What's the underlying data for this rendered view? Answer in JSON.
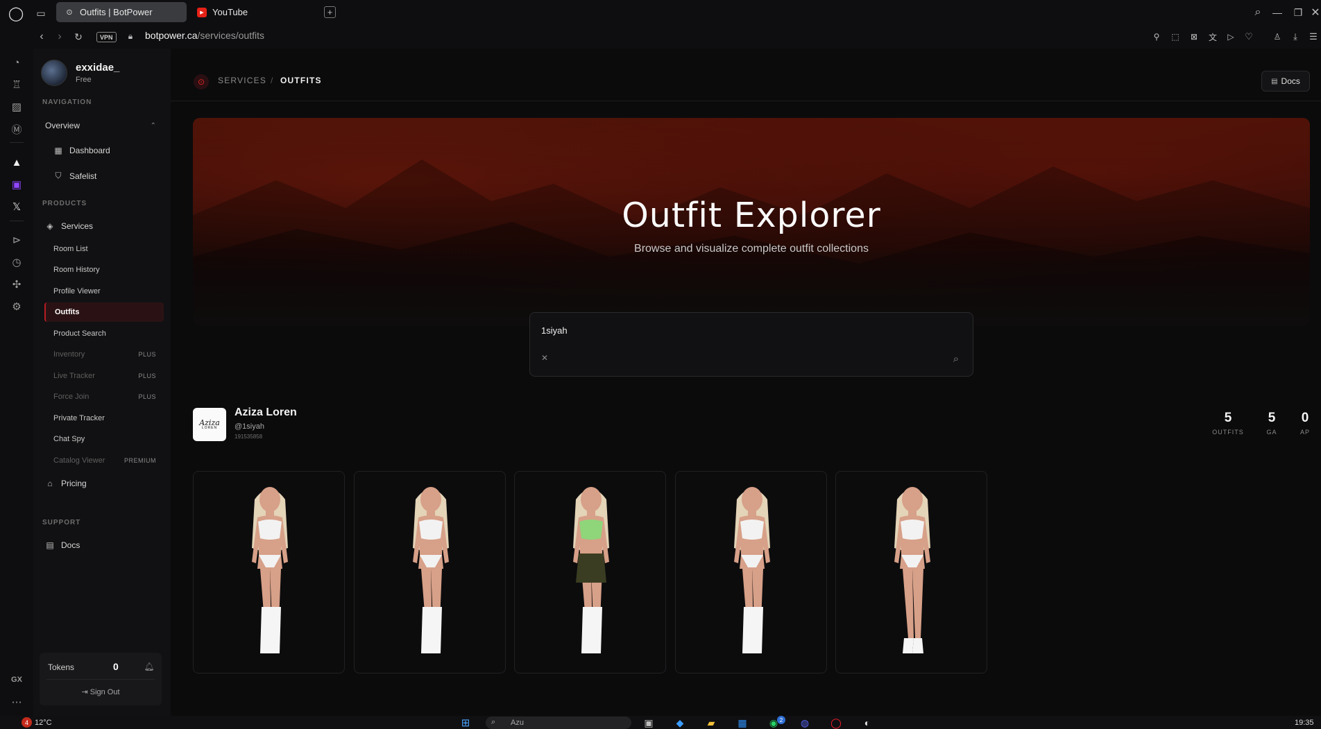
{
  "browser": {
    "tabs": [
      {
        "label": "Outfits | BotPower",
        "active": true
      },
      {
        "label": "YouTube",
        "active": false
      }
    ],
    "vpn_label": "VPN",
    "url_host": "botpower.ca",
    "url_path": "/services/outfits"
  },
  "user": {
    "name": "exxidae_",
    "plan": "Free"
  },
  "sidebar": {
    "nav_heading": "NAVIGATION",
    "overview_label": "Overview",
    "dashboard_label": "Dashboard",
    "safelist_label": "Safelist",
    "products_heading": "PRODUCTS",
    "services_label": "Services",
    "services_items": [
      {
        "label": "Room List",
        "badge": ""
      },
      {
        "label": "Room History",
        "badge": ""
      },
      {
        "label": "Profile Viewer",
        "badge": ""
      },
      {
        "label": "Outfits",
        "badge": ""
      },
      {
        "label": "Product Search",
        "badge": ""
      },
      {
        "label": "Inventory",
        "badge": "PLUS"
      },
      {
        "label": "Live Tracker",
        "badge": "PLUS"
      },
      {
        "label": "Force Join",
        "badge": "PLUS"
      },
      {
        "label": "Private Tracker",
        "badge": ""
      },
      {
        "label": "Chat Spy",
        "badge": ""
      },
      {
        "label": "Catalog Viewer",
        "badge": "PREMIUM"
      }
    ],
    "pricing_label": "Pricing",
    "support_heading": "SUPPORT",
    "docs_label": "Docs",
    "tokens_label": "Tokens",
    "tokens_value": "0",
    "signout_label": "Sign Out"
  },
  "breadcrumb": {
    "section": "SERVICES",
    "separator": "/",
    "current": "OUTFITS"
  },
  "header": {
    "docs_label": "Docs"
  },
  "hero": {
    "title": "Outfit Explorer",
    "subtitle": "Browse and visualize complete outfit collections"
  },
  "search": {
    "value": "1siyah"
  },
  "profile": {
    "display_name": "Aziza Loren",
    "handle": "@1siyah",
    "id": "191535858",
    "logo_text_1": "Aziza",
    "logo_text_2": "LOREN"
  },
  "stats": [
    {
      "value": "5",
      "label": "OUTFITS"
    },
    {
      "value": "5",
      "label": "GA"
    },
    {
      "value": "0",
      "label": "AP"
    }
  ],
  "outfits": [
    {
      "top": "white",
      "bottom": "white",
      "shoes": "white-boots"
    },
    {
      "top": "white",
      "bottom": "white",
      "shoes": "white-boots"
    },
    {
      "top": "green",
      "bottom": "olive-skirt",
      "shoes": "white-boots"
    },
    {
      "top": "white",
      "bottom": "white",
      "shoes": "white-boots"
    },
    {
      "top": "white",
      "bottom": "white",
      "shoes": "white-heels"
    }
  ],
  "taskbar": {
    "weather_badge": "4",
    "temperature": "12°C",
    "search_text": "Azu",
    "time": "19:35",
    "chat_badge": "2"
  },
  "colors": {
    "accent": "#b81d24",
    "background": "#0b0b0c",
    "skin": "#d7a088",
    "hair": "#e4d4b8"
  }
}
